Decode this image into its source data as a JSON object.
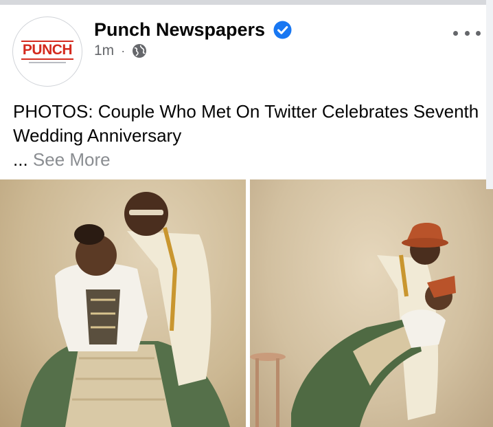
{
  "post": {
    "page_name": "Punch Newspapers",
    "timestamp": "1m",
    "separator": "·",
    "audience_icon": "globe-icon",
    "verified_icon": "verified-badge-icon",
    "verified_color": "#1877f2",
    "text": "PHOTOS: Couple Who Met On Twitter Celebrates Seventh Wedding Anniversary",
    "ellipsis": "...",
    "see_more_label": "See More",
    "avatar_logo": "PUNCH",
    "more_icon": "more-options-icon"
  },
  "photos": [
    {
      "description": "couple-photo-left"
    },
    {
      "description": "couple-photo-right"
    }
  ],
  "colors": {
    "brand_red": "#d42a1e",
    "text_primary": "#050505",
    "text_secondary": "#65676b",
    "see_more": "#8a8d91"
  }
}
